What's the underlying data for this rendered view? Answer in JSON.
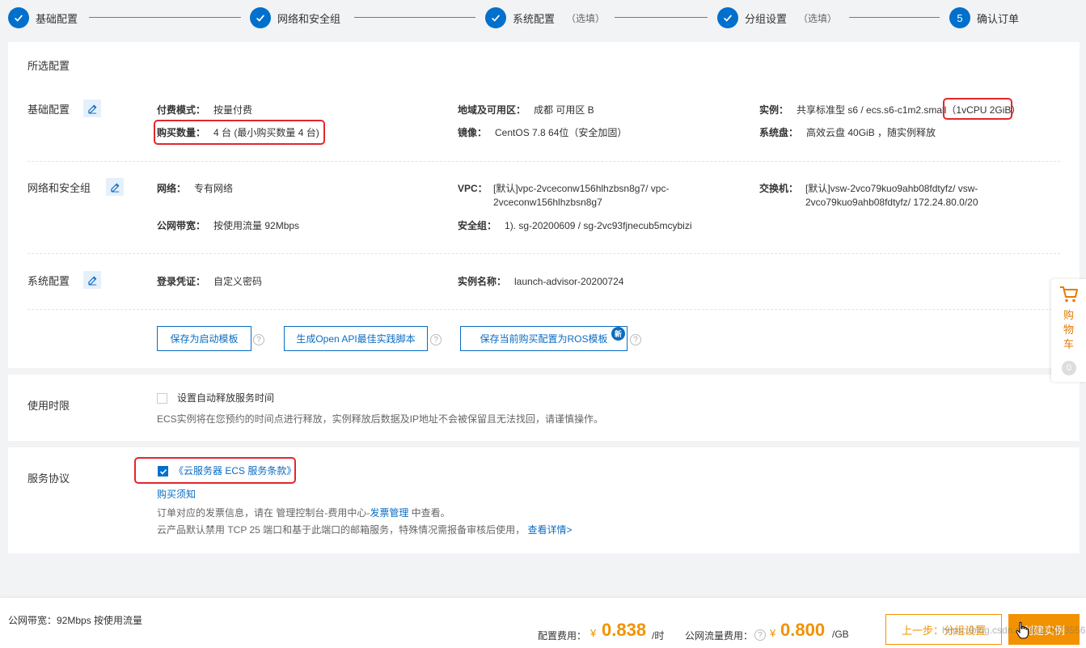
{
  "steps": [
    {
      "label": "基础配置",
      "optional": "",
      "number": ""
    },
    {
      "label": "网络和安全组",
      "optional": "",
      "number": ""
    },
    {
      "label": "系统配置",
      "optional": "（选填）",
      "number": ""
    },
    {
      "label": "分组设置",
      "optional": "（选填）",
      "number": ""
    },
    {
      "label": "确认订单",
      "optional": "",
      "number": "5"
    }
  ],
  "summary": {
    "title": "所选配置",
    "basic": {
      "title": "基础配置",
      "billing_key": "付费模式：",
      "billing_val": "按量付费",
      "qty_key": "购买数量：",
      "qty_val": "4 台 (最小购买数量 4 台)",
      "region_key": "地域及可用区：",
      "region_val": "成都 可用区 B",
      "image_key": "镜像：",
      "image_val": "CentOS 7.8 64位（安全加固）",
      "instance_key": "实例：",
      "instance_val": "共享标准型 s6 / ecs.s6-c1m2.small",
      "instance_spec": "（1vCPU 2GiB）",
      "disk_key": "系统盘：",
      "disk_val": "高效云盘 40GiB ，随实例释放"
    },
    "network": {
      "title": "网络和安全组",
      "net_key": "网络：",
      "net_val": "专有网络",
      "vpc_key": "VPC：",
      "vpc_val": "[默认]vpc-2vceconw156hlhzbsn8g7/ vpc-2vceconw156hlhzbsn8g7",
      "switch_key": "交换机：",
      "switch_val": "[默认]vsw-2vco79kuo9ahb08fdtyfz/ vsw-2vco79kuo9ahb08fdtyfz/ 172.24.80.0/20",
      "bw_key": "公网带宽：",
      "bw_val": "按使用流量 92Mbps",
      "sg_key": "安全组：",
      "sg_val": "1). sg-20200609 / sg-2vc93fjnecub5mcybizi"
    },
    "system": {
      "title": "系统配置",
      "login_key": "登录凭证：",
      "login_val": "自定义密码",
      "name_key": "实例名称：",
      "name_val": "launch-advisor-20200724"
    },
    "buttons": {
      "save_template": "保存为启动模板",
      "openapi": "生成Open API最佳实践脚本",
      "ros": "保存当前购买配置为ROS模板",
      "new_badge": "新"
    }
  },
  "duration": {
    "title": "使用时限",
    "checkbox_label": "设置自动释放服务时间",
    "note": "ECS实例将在您预约的时间点进行释放，实例释放后数据及IP地址不会被保留且无法找回，请谨慎操作。"
  },
  "agreement": {
    "title": "服务协议",
    "terms": "《云服务器 ECS 服务条款》",
    "purchase_notice": "购买须知",
    "invoice_pre": "订单对应的发票信息，请在 管理控制台-费用中心-",
    "invoice_link": "发票管理",
    "invoice_post": " 中查看。",
    "tcp_note": "云产品默认禁用 TCP 25 端口和基于此端口的邮箱服务，特殊情况需报备审核后使用，",
    "detail_link": "查看详情>"
  },
  "cart": {
    "label": "购物车",
    "count": "0"
  },
  "footer": {
    "bandwidth": "公网带宽：92Mbps 按使用流量",
    "config_fee_label": "配置费用：",
    "currency": "¥",
    "config_fee": "0.838",
    "config_unit": "/时",
    "traffic_fee_label": "公网流量费用：",
    "traffic_fee": "0.800",
    "traffic_unit": "/GB",
    "prev_button": "上一步：分组设置",
    "create_button": "创建实例",
    "watermark": "https://blog.csdn.net/u014073556"
  },
  "colors": {
    "primary": "#0070cc",
    "accent": "#f29200",
    "highlight": "#e3262b"
  }
}
